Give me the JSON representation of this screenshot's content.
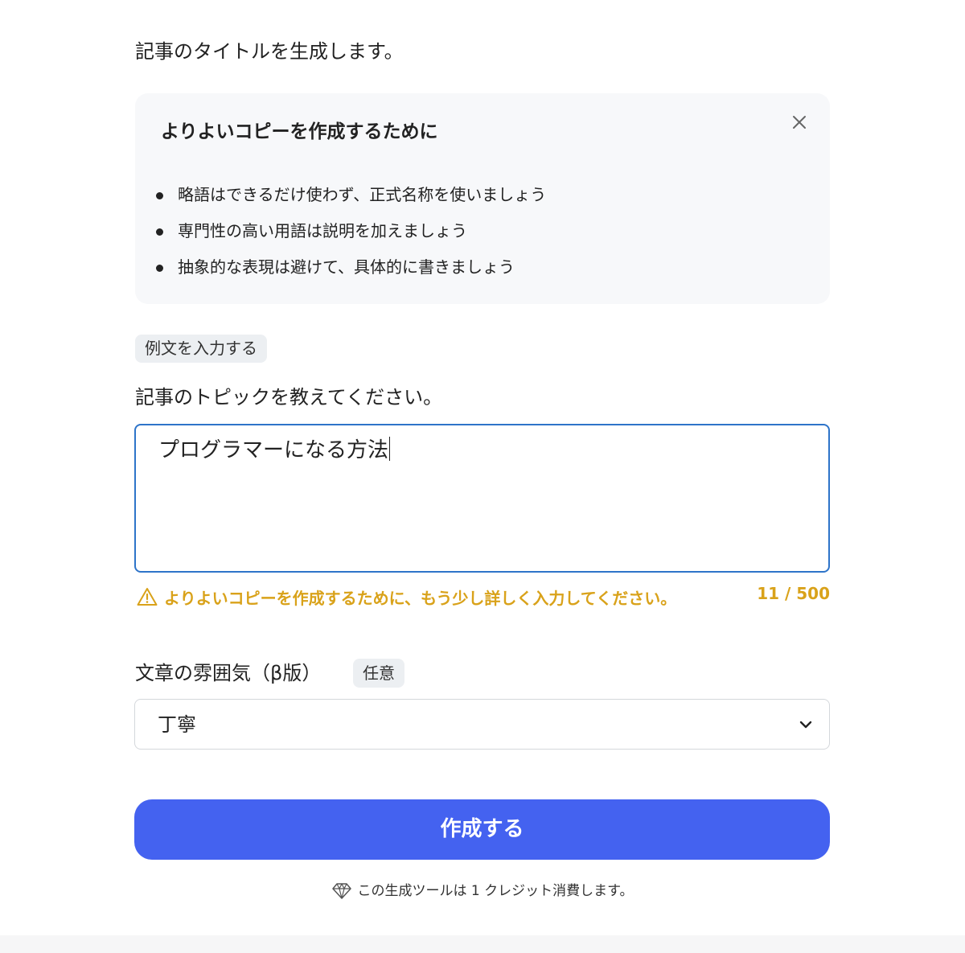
{
  "description": "記事のタイトルを生成します。",
  "tips": {
    "title": "よりよいコピーを作成するために",
    "close_icon": "close-icon",
    "items": [
      "略語はできるだけ使わず、正式名称を使いましょう",
      "専門性の高い用語は説明を加えましょう",
      "抽象的な表現は避けて、具体的に書きましょう"
    ]
  },
  "example_button": "例文を入力する",
  "topic": {
    "label": "記事のトピックを教えてください。",
    "value": "プログラマーになる方法",
    "warning": "よりよいコピーを作成するために、もう少し詳しく入力してください。",
    "warning_icon": "warning-triangle-icon",
    "counter": "11 / 500"
  },
  "tone": {
    "label": "文章の雰囲気（β版）",
    "optional_badge": "任意",
    "selected": "丁寧",
    "dropdown_icon": "chevron-down-icon"
  },
  "submit_label": "作成する",
  "credit_note": "この生成ツールは 1 クレジット消費します。",
  "colors": {
    "primary": "#4462f0",
    "warning": "#d9a21a",
    "focus_border": "#2e74c9",
    "panel_bg": "#f7f8fa"
  }
}
